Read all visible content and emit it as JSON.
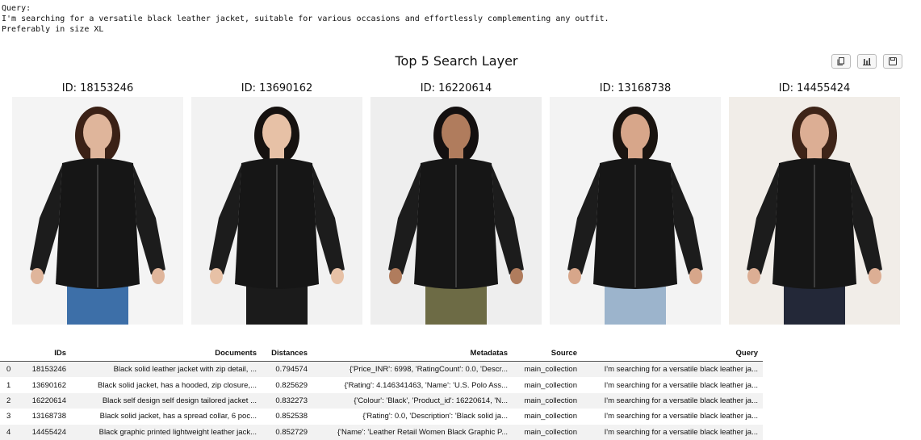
{
  "query": {
    "label": "Query:",
    "line1": "I'm searching for a versatile black leather jacket, suitable for various occasions and effortlessly complementing any outfit.",
    "line2": "Preferably in size XL"
  },
  "figure": {
    "title": "Top 5 Search Layer",
    "toolbar": [
      {
        "icon": "copy-icon"
      },
      {
        "icon": "bar-chart-icon"
      },
      {
        "icon": "save-icon"
      }
    ]
  },
  "gallery": [
    {
      "id_label": "ID: 18153246",
      "image": "jacket-photo-1",
      "skin": "#dfb59b",
      "hair": "#3b2116",
      "bottom": "#3d6fa8",
      "bg": "#f4f4f4"
    },
    {
      "id_label": "ID: 13690162",
      "image": "jacket-photo-2",
      "skin": "#e7c1a6",
      "hair": "#161210",
      "bottom": "#1b1b1b",
      "bg": "#f2f2f2"
    },
    {
      "id_label": "ID: 16220614",
      "image": "jacket-photo-3",
      "skin": "#b07c5d",
      "hair": "#141010",
      "bottom": "#6d6b45",
      "bg": "#eeeeee"
    },
    {
      "id_label": "ID: 13168738",
      "image": "jacket-photo-4",
      "skin": "#d7a68a",
      "hair": "#1a1410",
      "bottom": "#9cb4cc",
      "bg": "#f3f3f3"
    },
    {
      "id_label": "ID: 14455424",
      "image": "jacket-photo-5",
      "skin": "#dcae94",
      "hair": "#3e2418",
      "bottom": "#232838",
      "bg": "#f1ede8"
    }
  ],
  "table": {
    "columns": [
      "",
      "IDs",
      "Documents",
      "Distances",
      "Metadatas",
      "Source",
      "Query"
    ],
    "rows": [
      [
        "0",
        "18153246",
        "Black solid leather jacket with zip detail, ...",
        "0.794574",
        "{'Price_INR': 6998, 'RatingCount': 0.0, 'Descr...",
        "main_collection",
        "I'm searching for a versatile black leather ja..."
      ],
      [
        "1",
        "13690162",
        "Black solid jacket, has a hooded, zip closure,...",
        "0.825629",
        "{'Rating': 4.146341463, 'Name': 'U.S. Polo Ass...",
        "main_collection",
        "I'm searching for a versatile black leather ja..."
      ],
      [
        "2",
        "16220614",
        "Black self design self design tailored jacket ...",
        "0.832273",
        "{'Colour': 'Black', 'Product_id': 16220614, 'N...",
        "main_collection",
        "I'm searching for a versatile black leather ja..."
      ],
      [
        "3",
        "13168738",
        "Black solid jacket, has a spread collar, 6 poc...",
        "0.852538",
        "{'Rating': 0.0, 'Description': 'Black solid ja...",
        "main_collection",
        "I'm searching for a versatile black leather ja..."
      ],
      [
        "4",
        "14455424",
        "Black graphic printed lightweight leather jack...",
        "0.852729",
        "{'Name': 'Leather Retail Women Black Graphic P...",
        "main_collection",
        "I'm searching for a versatile black leather ja..."
      ]
    ]
  }
}
